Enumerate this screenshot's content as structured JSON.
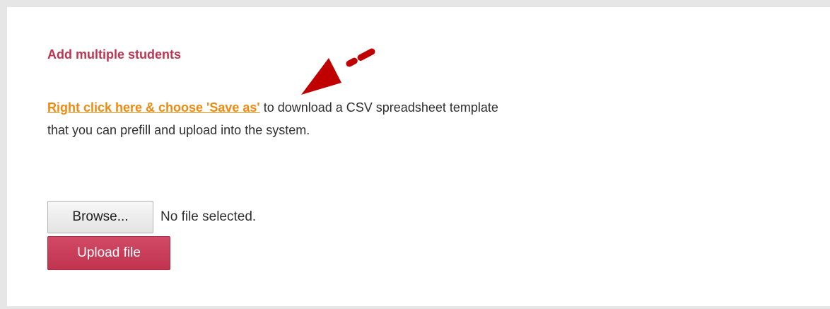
{
  "section": {
    "heading": "Add multiple students"
  },
  "instructions": {
    "link_text": "Right click here & choose 'Save as'",
    "body_text": " to download a CSV spreadsheet template that you can prefill and upload into the system."
  },
  "file_input": {
    "browse_label": "Browse...",
    "status": "No file selected."
  },
  "upload": {
    "button_label": "Upload file"
  },
  "colors": {
    "heading": "#c0344f",
    "link": "#ef8a10",
    "upload_button": "#c0344f",
    "arrow": "#c00000"
  }
}
